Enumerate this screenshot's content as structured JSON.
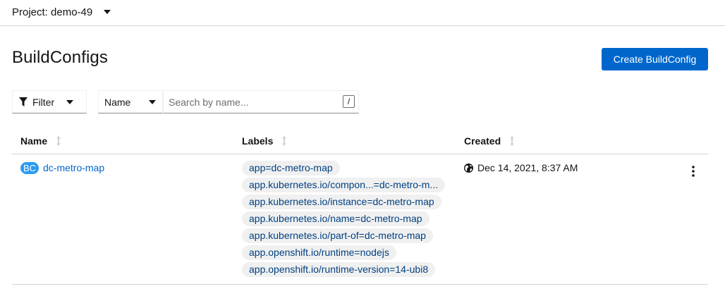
{
  "project": {
    "label": "Project: demo-49"
  },
  "page": {
    "title": "BuildConfigs",
    "create_label": "Create BuildConfig"
  },
  "filter": {
    "filter_label": "Filter",
    "name_label": "Name",
    "search_placeholder": "Search by name...",
    "shortcut_key": "/"
  },
  "table": {
    "columns": [
      "Name",
      "Labels",
      "Created"
    ],
    "rows": [
      {
        "badge": "BC",
        "name": "dc-metro-map",
        "labels": [
          "app=dc-metro-map",
          "app.kubernetes.io/compon...=dc-metro-m...",
          "app.kubernetes.io/instance=dc-metro-map",
          "app.kubernetes.io/name=dc-metro-map",
          "app.kubernetes.io/part-of=dc-metro-map",
          "app.openshift.io/runtime=nodejs",
          "app.openshift.io/runtime-version=14-ubi8"
        ],
        "created": "Dec 14, 2021, 8:37 AM"
      }
    ]
  },
  "icons": [
    "caret-down-icon",
    "filter-icon",
    "sort-icon",
    "globe-icon",
    "kebab-icon"
  ],
  "colors": {
    "primary": "#0066cc",
    "badge": "#2b9af3",
    "chip_bg": "#f0f0f0",
    "chip_text": "#004080"
  }
}
